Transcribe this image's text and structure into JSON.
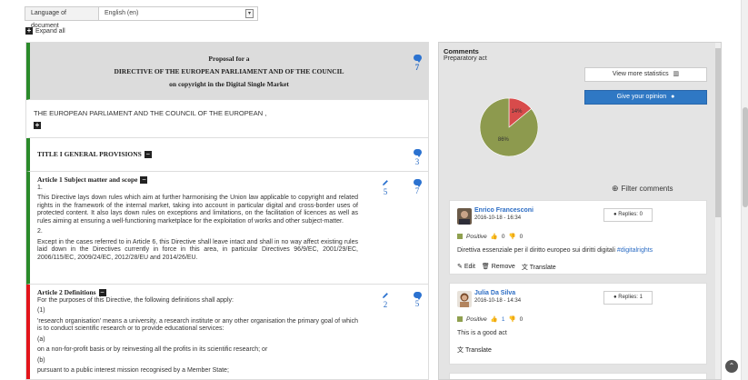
{
  "language": {
    "label": "Language of document",
    "value": "English (en)"
  },
  "expand_all": "Expand all",
  "proposal": {
    "line1": "Proposal for a",
    "line2": "DIRECTIVE OF THE EUROPEAN PARLIAMENT AND OF THE COUNCIL",
    "line3": "on copyright in the Digital Single Market",
    "comments": "7"
  },
  "parliament": "THE EUROPEAN PARLIAMENT AND THE COUNCIL OF THE EUROPEAN ,",
  "title1": {
    "label": "TITLE I GENERAL PROVISIONS",
    "comments": "3"
  },
  "article1": {
    "title": "Article 1 Subject matter and scope",
    "edits": "5",
    "comments": "7",
    "n1": "1.",
    "p1": "This Directive lays down rules which aim at further harmonising the Union law applicable to copyright and related rights in the framework of the internal market, taking into account in particular digital and cross-border uses of protected content. It also lays down rules on exceptions and limitations, on the facilitation of licences as well as rules aiming at ensuring a well-functioning marketplace for the exploitation of works and other subject-matter.",
    "n2": "2.",
    "p2": "Except in the cases referred to in Article 6, this Directive shall leave intact and shall in no way affect existing rules laid down in the Directives currently in force in this area, in particular Directives 96/9/EC, 2001/29/EC, 2006/115/EC, 2009/24/EC, 2012/28/EU and 2014/26/EU."
  },
  "article2": {
    "title": "Article 2 Definitions",
    "edits": "2",
    "comments": "5",
    "intro": "For the purposes of this Directive, the following definitions shall apply:",
    "n1": "(1)",
    "p1": "'research organisation' means a university, a research institute or any other organisation the primary goal of which is to conduct scientific research or to provide educational services:",
    "na": "(a)",
    "pa": "on a non-for-profit basis or by reinvesting all the profits in its scientific research; or",
    "nb": "(b)",
    "pb": "pursuant to a public interest mission recognised by a Member State;"
  },
  "comments_panel": {
    "title": "Comments",
    "subtitle": "Preparatory act",
    "stats_button": "View more statistics",
    "opinion_button": "Give your opinion",
    "filter": "Filter comments"
  },
  "chart_data": {
    "type": "pie",
    "slices": [
      {
        "label": "14%",
        "value": 14,
        "color": "#d84b4b"
      },
      {
        "label": "86%",
        "value": 86,
        "color": "#8d9a4e"
      }
    ]
  },
  "comment_list": [
    {
      "author": "Enrico Francesconi",
      "date": "2016-10-18 - 16:34",
      "replies": "Replies: 0",
      "sentiment": "Positive",
      "likes": "0",
      "dislikes": "0",
      "text": "Direttiva essenziale per il diritto europeo sui diritti digitali",
      "tag": "#digitalrights",
      "actions": {
        "edit": "Edit",
        "remove": "Remove",
        "translate": "Translate"
      }
    },
    {
      "author": "Julia Da Silva",
      "date": "2016-10-18 - 14:34",
      "replies": "Replies: 1",
      "sentiment": "Positive",
      "likes": "1",
      "dislikes": "0",
      "text": "This is a good act",
      "actions": {
        "translate": "Translate"
      }
    }
  ]
}
